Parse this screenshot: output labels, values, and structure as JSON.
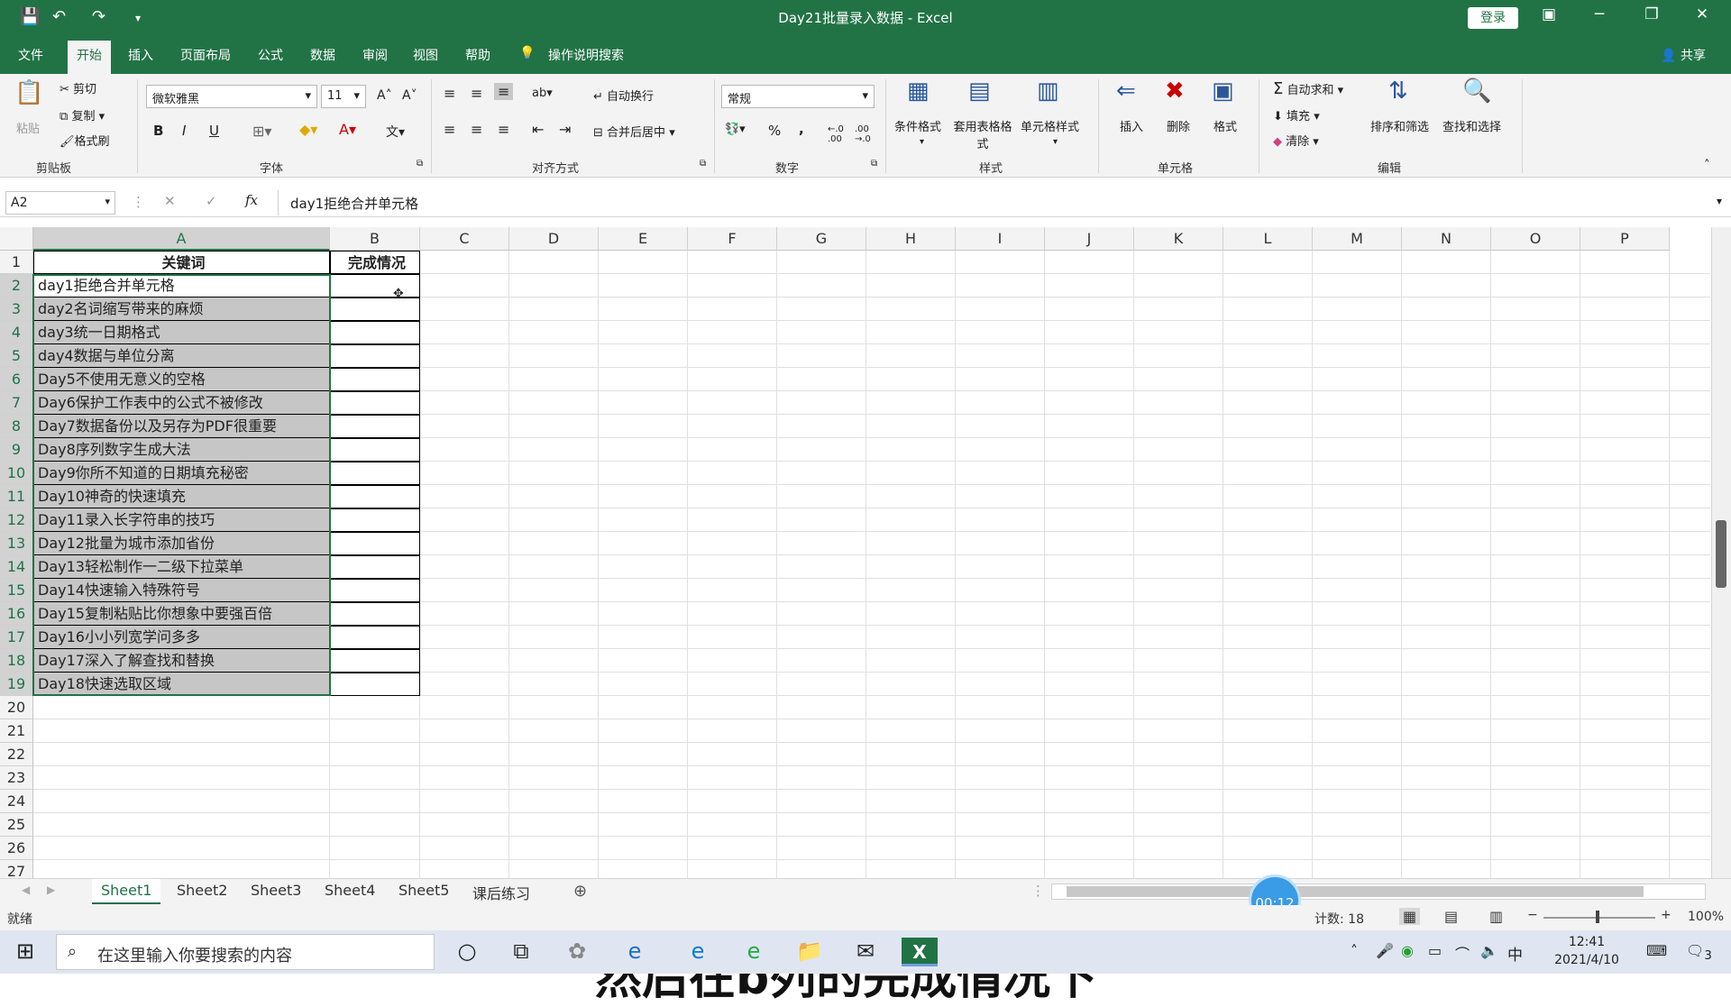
{
  "window": {
    "title": "Day21批量录入数据  -  Excel",
    "login": "登录",
    "minimize": "─",
    "restore": "❐",
    "close": "✕"
  },
  "menu": {
    "items": [
      "文件",
      "开始",
      "插入",
      "页面布局",
      "公式",
      "数据",
      "审阅",
      "视图",
      "帮助"
    ],
    "active_index": 1,
    "search": "操作说明搜索",
    "share": "共享"
  },
  "ribbon": {
    "clipboard": {
      "paste": "粘贴",
      "cut": "剪切",
      "copy": "复制",
      "format_painter": "格式刷",
      "group": "剪贴板"
    },
    "font": {
      "name": "微软雅黑",
      "size": "11",
      "bold": "B",
      "italic": "I",
      "underline": "U",
      "group": "字体"
    },
    "alignment": {
      "wrap": "自动换行",
      "merge": "合并后居中",
      "group": "对齐方式"
    },
    "number": {
      "format": "常规",
      "percent": "%",
      "comma": ",",
      "group": "数字"
    },
    "styles": {
      "conditional": "条件格式",
      "table": "套用表格格式",
      "cell_styles": "单元格样式",
      "group": "样式"
    },
    "cells": {
      "insert": "插入",
      "delete": "删除",
      "format": "格式",
      "group": "单元格"
    },
    "editing": {
      "autosum": "自动求和",
      "fill": "填充",
      "clear": "清除",
      "sort": "排序和筛选",
      "find": "查找和选择",
      "group": "编辑"
    }
  },
  "formula_bar": {
    "name_box": "A2",
    "cancel": "✕",
    "enter": "✓",
    "fx": "fx",
    "content": "day1拒绝合并单元格"
  },
  "grid": {
    "columns": [
      "A",
      "B",
      "C",
      "D",
      "E",
      "F",
      "G",
      "H",
      "I",
      "J",
      "K",
      "L",
      "M",
      "N",
      "O",
      "P"
    ],
    "rows": [
      "1",
      "2",
      "3",
      "4",
      "5",
      "6",
      "7",
      "8",
      "9",
      "10",
      "11",
      "12",
      "13",
      "14",
      "15",
      "16",
      "17",
      "18",
      "19",
      "20",
      "21",
      "22",
      "23",
      "24",
      "25",
      "26",
      "27"
    ],
    "header_a": "关键词",
    "header_b": "完成情况",
    "keywords": [
      "day1拒绝合并单元格",
      "day2名词缩写带来的麻烦",
      "day3统一日期格式",
      "day4数据与单位分离",
      "Day5不使用无意义的空格",
      "Day6保护工作表中的公式不被修改",
      "Day7数据备份以及另存为PDF很重要",
      "Day8序列数字生成大法",
      "Day9你所不知道的日期填充秘密",
      "Day10神奇的快速填充",
      "Day11录入长字符串的技巧",
      "Day12批量为城市添加省份",
      "Day13轻松制作一二级下拉菜单",
      "Day14快速输入特殊符号",
      "Day15复制粘贴比你想象中要强百倍",
      "Day16小小列宽学问多多",
      "Day17深入了解查找和替换",
      "Day18快速选取区域"
    ]
  },
  "caption": "然后在b列的完成情况下",
  "sheets": {
    "tabs": [
      "Sheet1",
      "Sheet2",
      "Sheet3",
      "Sheet4",
      "Sheet5",
      "课后练习"
    ],
    "active_index": 0
  },
  "status": {
    "mode": "就绪",
    "count": "计数: 18",
    "zoom": "100%",
    "timer": "00:12"
  },
  "taskbar": {
    "search_placeholder": "在这里输入你要搜索的内容",
    "time": "12:41",
    "date": "2021/4/10",
    "ime": "中",
    "notifications": "3"
  },
  "colors": {
    "accent": "#217346",
    "selection": "#c6c6c6"
  }
}
